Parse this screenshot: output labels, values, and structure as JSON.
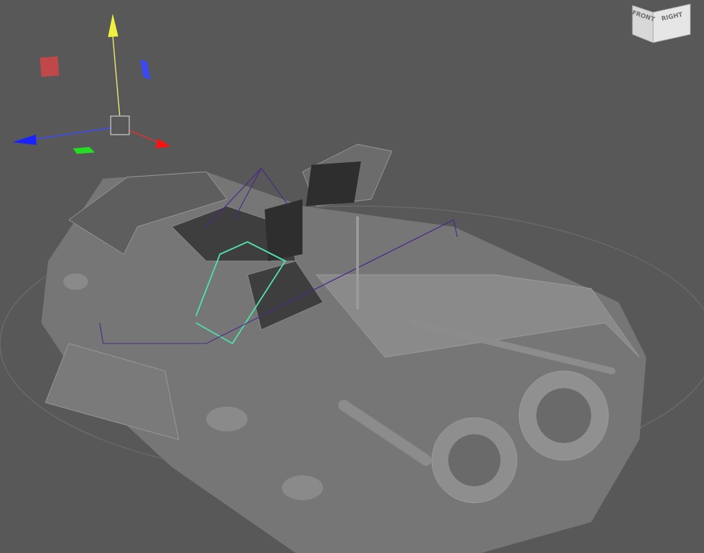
{
  "view_cube": {
    "faces": [
      "FRONT",
      "RIGHT"
    ]
  }
}
